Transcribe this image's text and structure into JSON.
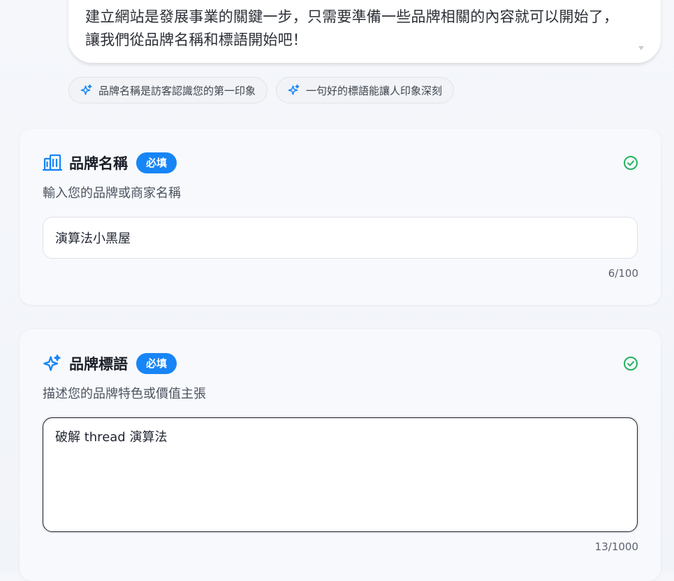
{
  "assistant_message": {
    "text": "建立網站是發展事業的關鍵一步，只需要準備一些品牌相關的內容就可以開始了，讓我們從品牌名稱和標語開始吧！"
  },
  "suggestion_chips": [
    {
      "label": "品牌名稱是訪客認識您的第一印象",
      "icon": "sparkle-icon"
    },
    {
      "label": "一句好的標語能讓人印象深刻",
      "icon": "sparkle-icon"
    }
  ],
  "brand_name_card": {
    "title": "品牌名稱",
    "badge": "必填",
    "description": "輸入您的品牌或商家名稱",
    "value": "演算法小黑屋",
    "counter": "6/100",
    "icon": "building-icon",
    "status_icon": "check-circle-icon"
  },
  "brand_slogan_card": {
    "title": "品牌標語",
    "badge": "必填",
    "description": "描述您的品牌特色或價值主張",
    "value": "破解 thread 演算法",
    "counter": "13/1000",
    "icon": "sparkle-icon",
    "status_icon": "check-circle-icon"
  },
  "colors": {
    "accent": "#1785f6",
    "success": "#22b35e",
    "text": "#1f2937"
  }
}
